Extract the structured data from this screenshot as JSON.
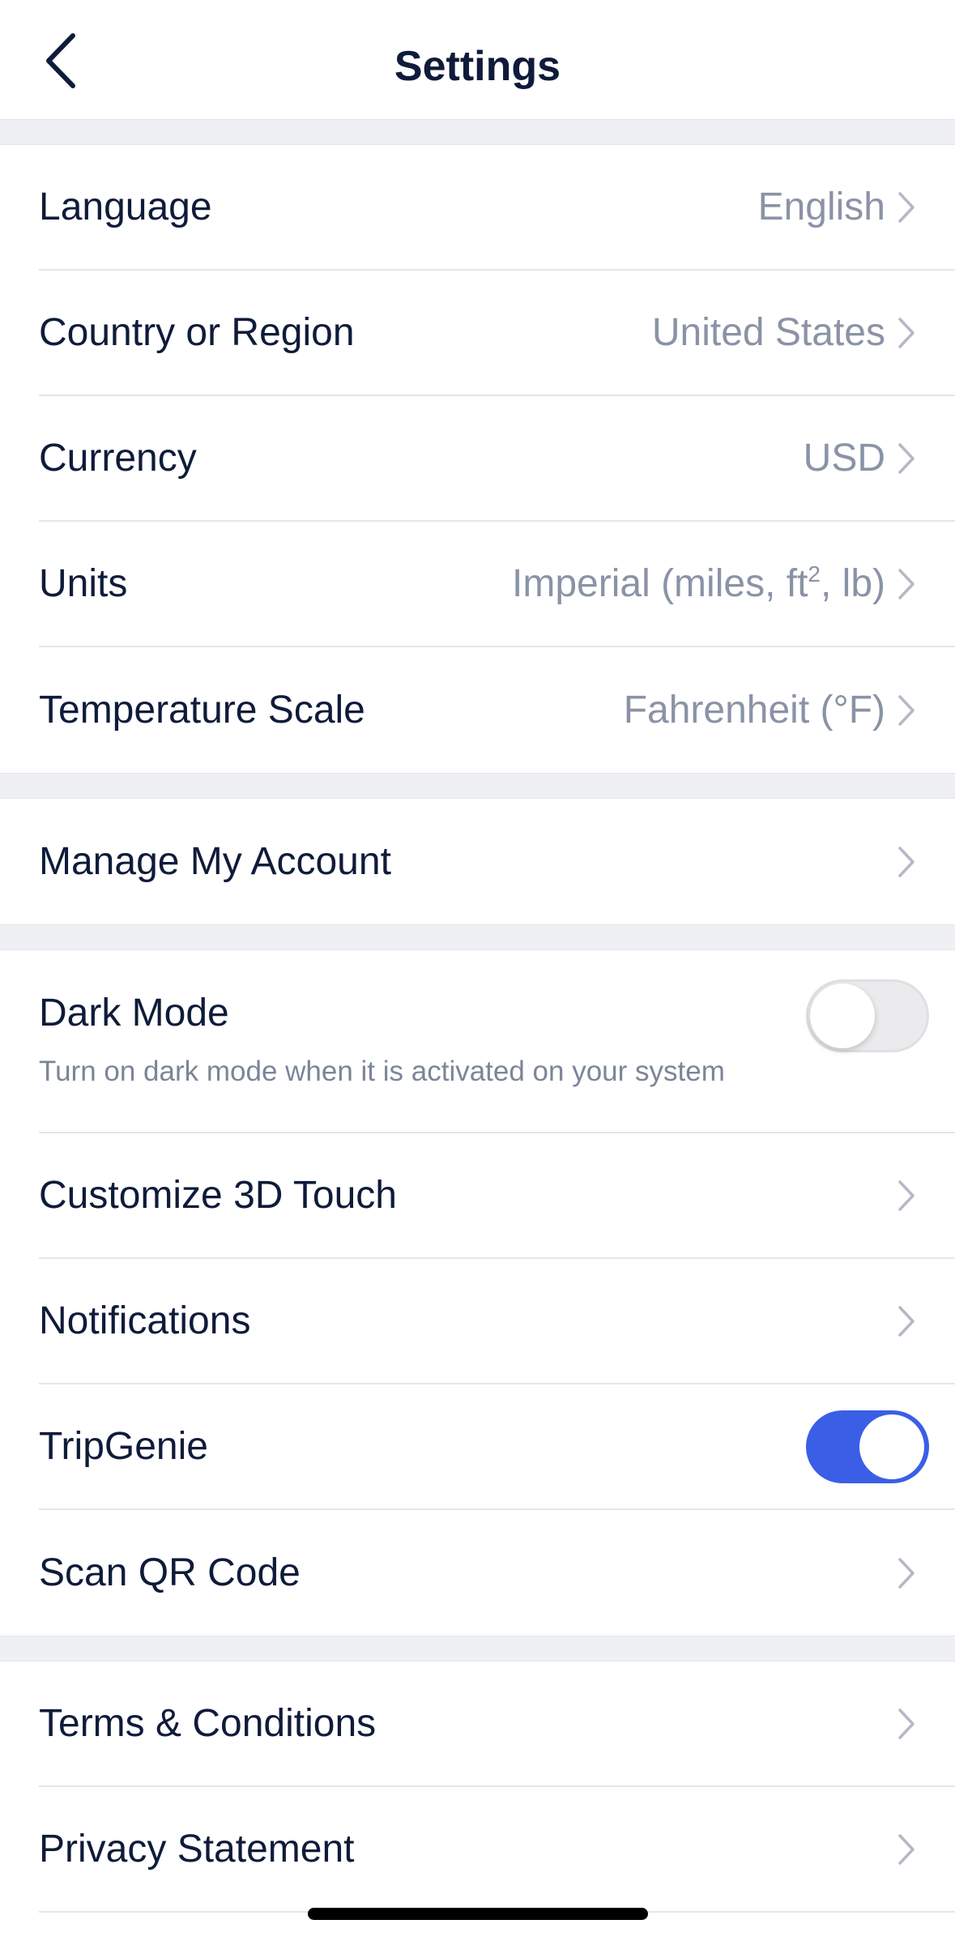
{
  "header": {
    "title": "Settings",
    "back_icon": "chevron-left-icon"
  },
  "preferences": {
    "language": {
      "label": "Language",
      "value": "English"
    },
    "country": {
      "label": "Country or Region",
      "value": "United States"
    },
    "currency": {
      "label": "Currency",
      "value": "USD"
    },
    "units": {
      "label": "Units",
      "value_prefix": "Imperial (miles, ft",
      "value_sup": "2",
      "value_suffix": ", lb)"
    },
    "temperature": {
      "label": "Temperature Scale",
      "value": "Fahrenheit (°F)"
    }
  },
  "account": {
    "manage": {
      "label": "Manage My Account"
    }
  },
  "features": {
    "dark_mode": {
      "label": "Dark Mode",
      "description": "Turn on dark mode when it is activated on your system",
      "enabled": false
    },
    "touch_3d": {
      "label": "Customize 3D Touch"
    },
    "notifications": {
      "label": "Notifications"
    },
    "tripgenie": {
      "label": "TripGenie",
      "enabled": true
    },
    "scan_qr": {
      "label": "Scan QR Code"
    }
  },
  "legal": {
    "terms": {
      "label": "Terms & Conditions"
    },
    "privacy": {
      "label": "Privacy Statement"
    }
  },
  "colors": {
    "accent": "#3b5ee6",
    "text_primary": "#0f1b3a",
    "text_secondary": "#8a93a6",
    "section_bg": "#eff0f4"
  }
}
